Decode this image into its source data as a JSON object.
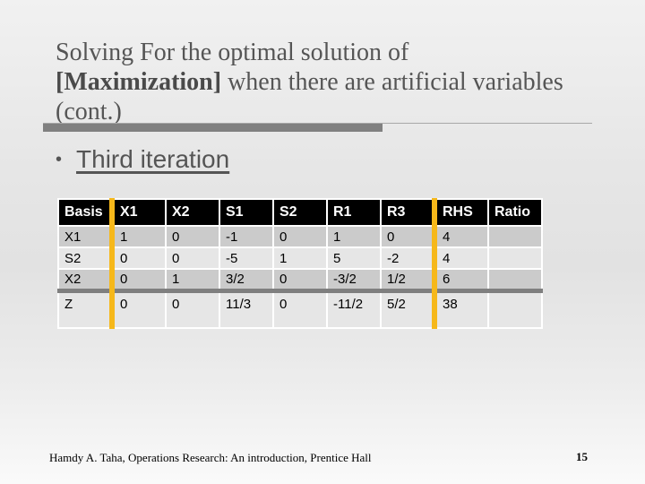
{
  "slide": {
    "title_line1": "Solving For the optimal solution of",
    "title_bold": "[Maximization]",
    "title_line2_rest": " when there are artificial variables",
    "title_line3": "(cont.)",
    "bullet": "Third iteration",
    "footer": "Hamdy A. Taha, Operations Research: An introduction, Prentice Hall",
    "page_number": "15"
  },
  "tableau": {
    "headers": [
      "Basis",
      "X1",
      "X2",
      "S1",
      "S2",
      "R1",
      "R3",
      "RHS",
      "Ratio"
    ],
    "rows": [
      [
        "X1",
        "1",
        "0",
        "-1",
        "0",
        "1",
        "0",
        "4",
        ""
      ],
      [
        "S2",
        "0",
        "0",
        "-5",
        "1",
        "5",
        "-2",
        "4",
        ""
      ],
      [
        "X2",
        "0",
        "1",
        "3/2",
        "0",
        "-3/2",
        "1/2",
        "6",
        ""
      ],
      [
        "Z",
        "0",
        "0",
        "11/3",
        "0",
        "-11/2",
        "5/2",
        "38",
        ""
      ]
    ]
  },
  "colors": {
    "header_bg": "#000000",
    "accent_separator": "#f6b81a",
    "row_dark": "#cbcbcb",
    "row_light": "#e6e6e6",
    "objective_separator": "#7f7f7f"
  }
}
